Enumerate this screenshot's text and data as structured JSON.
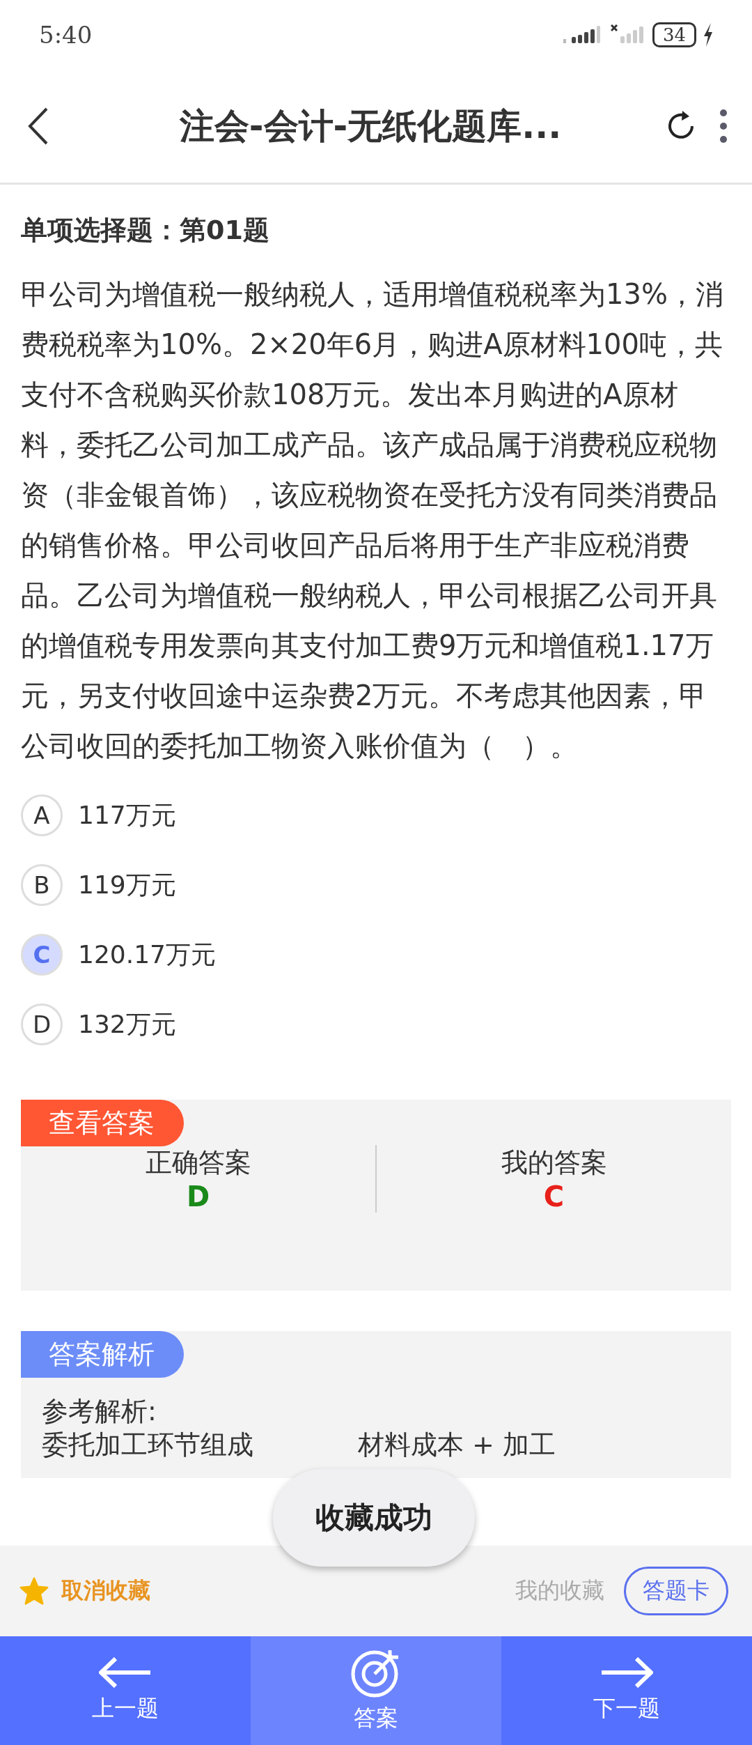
{
  "status_bar": {
    "time": "5:40",
    "battery": "34"
  },
  "header": {
    "title": "注会-会计-无纸化题库..."
  },
  "question": {
    "type_label": "单项选择题：第01题",
    "text": "甲公司为增值税一般纳税人，适用增值税税率为13%，消费税税率为10%。2×20年6月，购进A原材料100吨，共支付不含税购买价款108万元。发出本月购进的A原材料，委托乙公司加工成产品。该产成品属于消费税应税物资（非金银首饰），该应税物资在受托方没有同类消费品的销售价格。甲公司收回产品后将用于生产非应税消费品。乙公司为增值税一般纳税人，甲公司根据乙公司开具的增值税专用发票向其支付加工费9万元和增值税1.17万元，另支付收回途中运杂费2万元。不考虑其他因素，甲公司收回的委托加工物资入账价值为（　）。",
    "options": [
      {
        "letter": "A",
        "text": "117万元",
        "selected": false
      },
      {
        "letter": "B",
        "text": "119万元",
        "selected": false
      },
      {
        "letter": "C",
        "text": "120.17万元",
        "selected": true
      },
      {
        "letter": "D",
        "text": "132万元",
        "selected": false
      }
    ]
  },
  "answer_card": {
    "tag": "查看答案",
    "columns": [
      {
        "label": "正确答案",
        "value": "D",
        "color": "#1a8a1a"
      },
      {
        "label": "我的答案",
        "value": "C",
        "color": "#e8201a"
      }
    ]
  },
  "analysis": {
    "tag": "答案解析",
    "heading": "参考解析:",
    "line_start": "委托加工环节组成",
    "line_end": "材料成本 + 加工"
  },
  "toast": "收藏成功",
  "action_bar": {
    "favorite": "取消收藏",
    "favorited": true,
    "my_favorites": "我的收藏",
    "answer_sheet": "答题卡"
  },
  "nav": [
    {
      "kind": "prev",
      "label": "上一题",
      "selected": false
    },
    {
      "kind": "answer",
      "label": "答案",
      "selected": true
    },
    {
      "kind": "next",
      "label": "下一题",
      "selected": false
    }
  ]
}
